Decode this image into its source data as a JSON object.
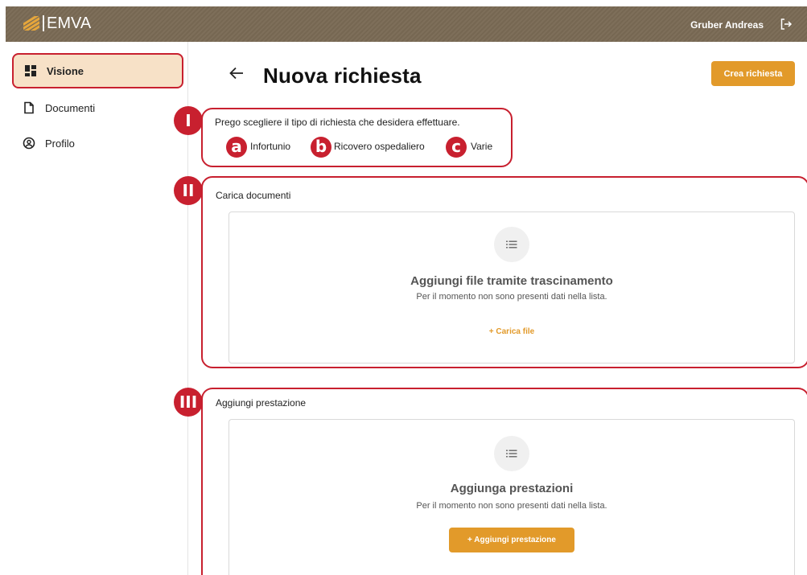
{
  "app": {
    "logo_text": "EMVA"
  },
  "header": {
    "user_name": "Gruber Andreas"
  },
  "sidebar": {
    "items": [
      {
        "label": "Visione",
        "icon": "dashboard-icon",
        "active": true
      },
      {
        "label": "Documenti",
        "icon": "document-icon",
        "active": false
      },
      {
        "label": "Profilo",
        "icon": "profile-icon",
        "active": false
      }
    ]
  },
  "page": {
    "title": "Nuova richiesta",
    "create_button": "Crea richiesta"
  },
  "request_type": {
    "prompt": "Prego scegliere il tipo di richiesta che desidera effettuare.",
    "options": [
      {
        "label": "Infortunio",
        "marker": "a"
      },
      {
        "label": "Ricovero ospedaliero",
        "marker": "b"
      },
      {
        "label": "Varie",
        "marker": "c"
      }
    ]
  },
  "documents": {
    "title": "Carica documenti",
    "empty_heading": "Aggiungi file tramite trascinamento",
    "empty_text": "Per il momento non sono presenti dati nella lista.",
    "action": "+   Carica file"
  },
  "services": {
    "title": "Aggiungi prestazione",
    "empty_heading": "Aggiunga prestazioni",
    "empty_text": "Per il momento non sono presenti dati nella lista.",
    "action": "+   Aggiungi prestazione"
  },
  "annotations": {
    "section_1": "I",
    "section_2": "II",
    "section_3": "III"
  },
  "colors": {
    "accent": "#e29a2a",
    "header_bg": "#7a6a55",
    "active_bg": "#f7e1c7",
    "annotation": "#c8202f"
  }
}
